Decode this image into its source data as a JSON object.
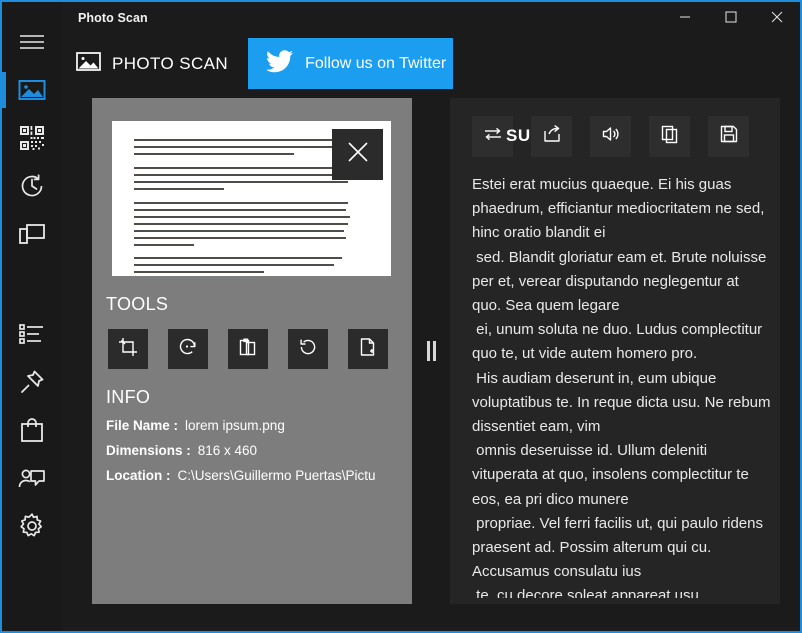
{
  "window": {
    "title": "Photo Scan",
    "controls": [
      {
        "name": "minimize",
        "glyph": "minimize-icon"
      },
      {
        "name": "maximize",
        "glyph": "maximize-icon"
      },
      {
        "name": "close",
        "glyph": "close-icon"
      }
    ]
  },
  "colors": {
    "accent": "#1f8ddd",
    "twitter": "#1b9df0",
    "app_bg": "#1b1b1b",
    "rail_bg": "#191919",
    "photo_panel_bg": "#7d7d7d",
    "text_panel_bg": "#252525",
    "button_bg": "#2b2b2b"
  },
  "sidebar": {
    "items": [
      {
        "icon": "hamburger-menu-icon",
        "label": "Menu",
        "selected": false
      },
      {
        "icon": "image-icon",
        "label": "Photo Scan",
        "selected": true
      },
      {
        "icon": "qr-code-icon",
        "label": "QR Code",
        "selected": false
      },
      {
        "icon": "history-clock-icon",
        "label": "History",
        "selected": false
      },
      {
        "icon": "devices-icon",
        "label": "Devices",
        "selected": false
      },
      {
        "icon": "list-icon",
        "label": "List",
        "selected": false
      },
      {
        "icon": "pin-icon",
        "label": "Pin",
        "selected": false
      },
      {
        "icon": "shopping-bag-icon",
        "label": "Store",
        "selected": false
      },
      {
        "icon": "feedback-icon",
        "label": "Feedback",
        "selected": false
      },
      {
        "icon": "settings-gear-icon",
        "label": "Settings",
        "selected": false
      }
    ]
  },
  "header": {
    "brand_icon": "image-icon",
    "brand_label": "PHOTO SCAN",
    "twitter_icon": "twitter-bird-icon",
    "twitter_label": "Follow us on Twitter"
  },
  "photo_panel": {
    "preview_close_icon": "close-icon",
    "tools_heading": "TOOLS",
    "tools": [
      {
        "icon": "crop-icon",
        "label": "Crop"
      },
      {
        "icon": "magic-rotate-icon",
        "label": "Auto enhance"
      },
      {
        "icon": "clipboard-icon",
        "label": "Copy image"
      },
      {
        "icon": "rotate-icon",
        "label": "Rotate"
      },
      {
        "icon": "new-document-icon",
        "label": "New scan"
      }
    ],
    "info_heading": "INFO",
    "info": [
      {
        "key": "File Name :",
        "value": "lorem ipsum.png"
      },
      {
        "key": "Dimensions :",
        "value": "816 x 460"
      },
      {
        "key": "Location :",
        "value": "C:\\Users\\Guillermo Puertas\\Pictu"
      }
    ]
  },
  "splitter": {
    "icon": "splitter-grip-icon"
  },
  "text_panel": {
    "language_label": "SU",
    "toolbar": [
      {
        "icon": "translate-swap-icon",
        "label": "Translate"
      },
      {
        "icon": "share-icon",
        "label": "Share"
      },
      {
        "icon": "speaker-icon",
        "label": "Read aloud"
      },
      {
        "icon": "copy-icon",
        "label": "Copy text"
      },
      {
        "icon": "save-icon",
        "label": "Save"
      }
    ],
    "ocr_text": "Estei erat mucius quaeque. Ei his guas phaedrum, efficiantur mediocritatem ne sed, hinc oratio blandit ei\n sed. Blandit gloriatur eam et. Brute noluisse per et, verear disputando neglegentur at quo. Sea quem legare\n ei, unum soluta ne duo. Ludus complectitur quo te, ut vide autem homero pro.\n His audiam deserunt in, eum ubique voluptatibus te. In reque dicta usu. Ne rebum dissentiet eam, vim\n omnis deseruisse id. Ullum deleniti vituperata at quo, insolens complectitur te eos, ea pri dico munere\n propriae. Vel ferri facilis ut, qui paulo ridens praesent ad. Possim alterum qui cu. Accusamus consulatu ius\n te, cu decore soleat appareat usu.\n Lorem ipsum dolor sit amet, consectetuer adipiscing elit, sed diam"
  }
}
